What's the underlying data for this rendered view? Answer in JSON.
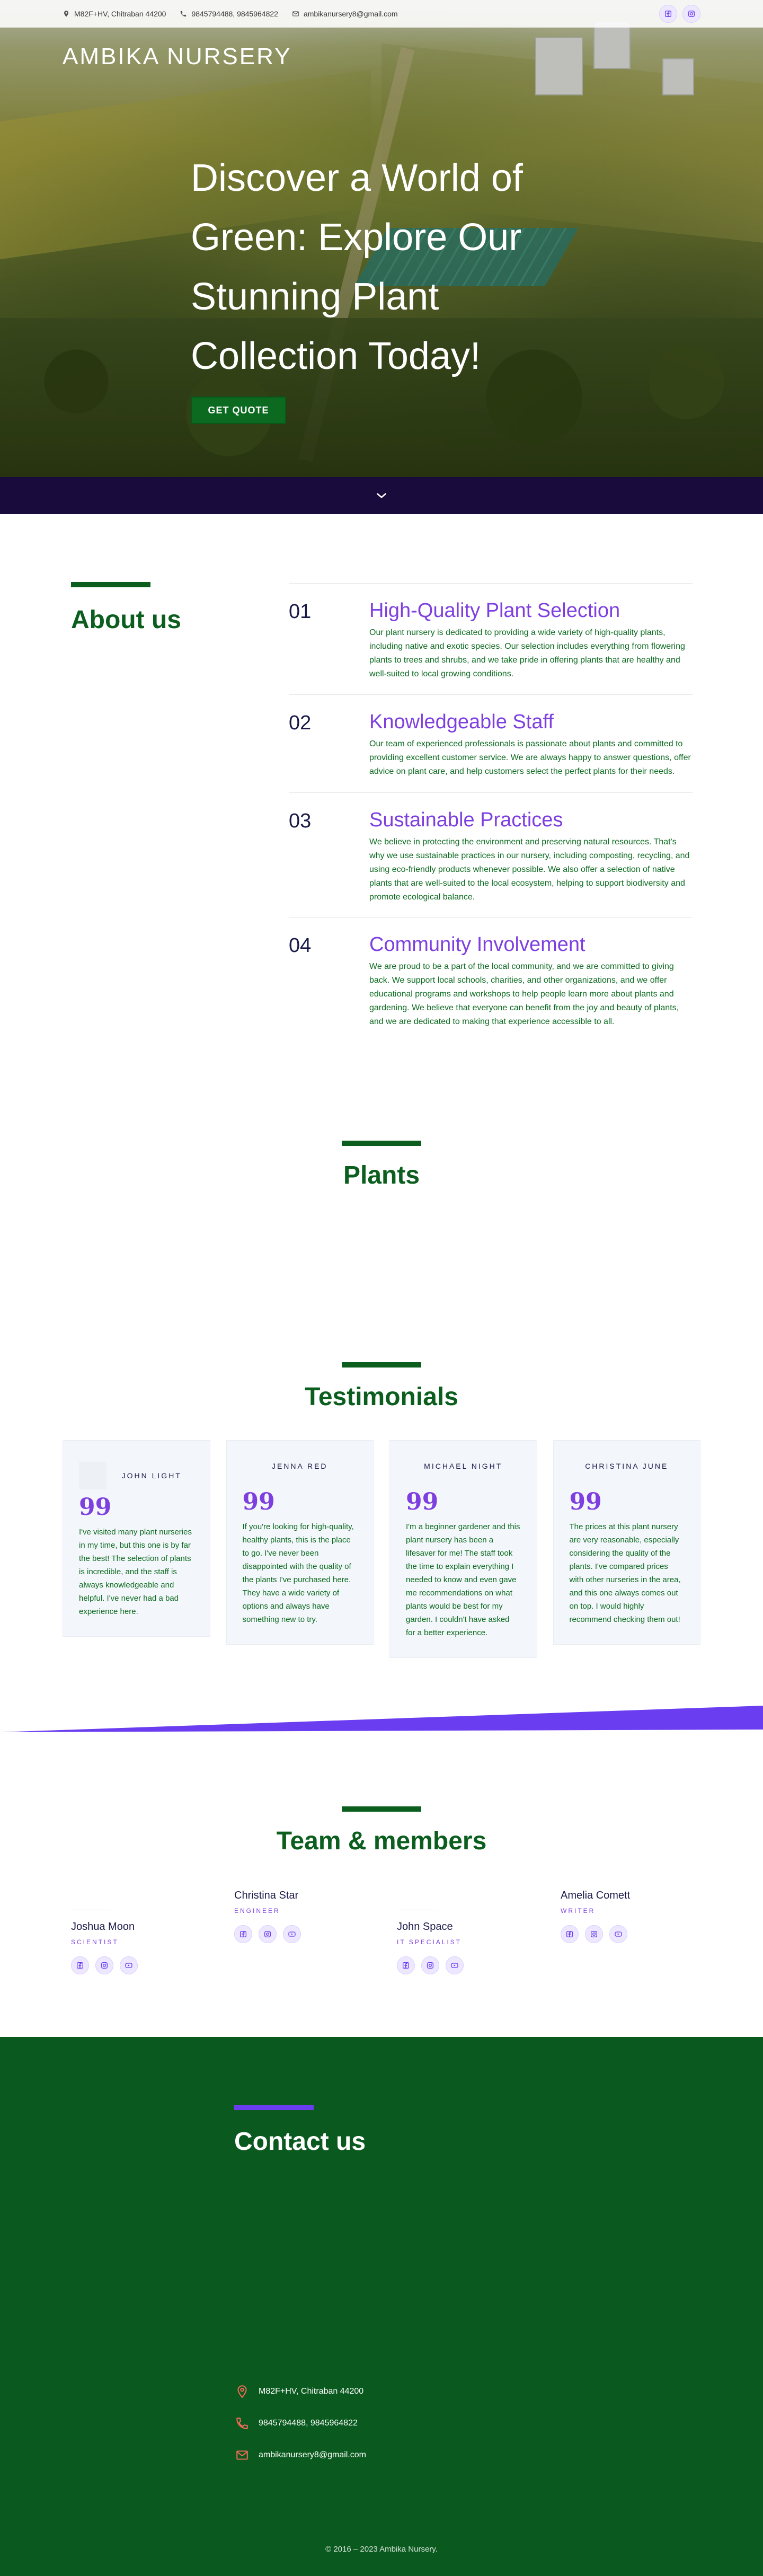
{
  "topbar": {
    "address": "M82F+HV, Chitraban 44200",
    "phone": "9845794488, 9845964822",
    "email": "ambikanursery8@gmail.com"
  },
  "hero": {
    "brand": "AMBIKA NURSERY",
    "title": "Discover a World of Green: Explore Our Stunning Plant Collection Today!",
    "cta": "GET QUOTE"
  },
  "about": {
    "heading": "About us",
    "items": [
      {
        "num": "01",
        "title": "High-Quality Plant Selection",
        "text": "Our plant nursery is dedicated to providing a wide variety of high-quality plants, including native and exotic species. Our selection includes everything from flowering plants to trees and shrubs, and we take pride in offering plants that are healthy and well-suited to local growing conditions."
      },
      {
        "num": "02",
        "title": "Knowledgeable Staff",
        "text": "Our team of experienced professionals is passionate about plants and committed to providing excellent customer service. We are always happy to answer questions, offer advice on plant care, and help customers select the perfect plants for their needs."
      },
      {
        "num": "03",
        "title": "Sustainable Practices",
        "text": "We believe in protecting the environment and preserving natural resources. That's why we use sustainable practices in our nursery, including composting, recycling, and using eco-friendly products whenever possible. We also offer a selection of native plants that are well-suited to the local ecosystem, helping to support biodiversity and promote ecological balance."
      },
      {
        "num": "04",
        "title": "Community Involvement",
        "text": "We are proud to be a part of the local community, and we are committed to giving back. We support local schools, charities, and other organizations, and we offer educational programs and workshops to help people learn more about plants and gardening. We believe that everyone can benefit from the joy and beauty of plants, and we are dedicated to making that experience accessible to all."
      }
    ]
  },
  "plants": {
    "heading": "Plants"
  },
  "testimonials": {
    "heading": "Testimonials",
    "cards": [
      {
        "name": "JOHN LIGHT",
        "quote_mark": "99",
        "text": "I've visited many plant nurseries in my time, but this one is by far the best! The selection of plants is incredible, and the staff is always knowledgeable and helpful. I've never had a bad experience here."
      },
      {
        "name": "JENNA RED",
        "quote_mark": "99",
        "text": "If you're looking for high-quality, healthy plants, this is the place to go. I've never been disappointed with the quality of the plants I've purchased here. They have a wide variety of options and always have something new to try."
      },
      {
        "name": "MICHAEL NIGHT",
        "quote_mark": "99",
        "text": "I'm a beginner gardener and this plant nursery has been a lifesaver for me! The staff took the time to explain everything I needed to know and even gave me recommendations on what plants would be best for my garden. I couldn't have asked for a better experience."
      },
      {
        "name": "CHRISTINA JUNE",
        "quote_mark": "99",
        "text": "The prices at this plant nursery are very reasonable, especially considering the quality of the plants. I've compared prices with other nurseries in the area, and this one always comes out on top. I would highly recommend checking them out!"
      }
    ]
  },
  "team": {
    "heading": "Team & members",
    "members": [
      {
        "name": "Joshua Moon",
        "role": "SCIENTIST"
      },
      {
        "name": "Christina Star",
        "role": "ENGINEER"
      },
      {
        "name": "John Space",
        "role": "IT SPECIALIST"
      },
      {
        "name": "Amelia Comett",
        "role": "WRITER"
      }
    ]
  },
  "contact": {
    "heading": "Contact us",
    "address": "M82F+HV, Chitraban 44200",
    "phone": "9845794488, 9845964822",
    "email": "ambikanursery8@gmail.com"
  },
  "footer": {
    "copyright": "© 2016 – 2023 Ambika Nursery."
  },
  "colors": {
    "green": "#0b5e1e",
    "purple": "#7e3fe0",
    "navy": "#1a0b3d"
  },
  "icons": [
    "map-pin-icon",
    "phone-icon",
    "mail-icon",
    "facebook-icon",
    "instagram-icon",
    "youtube-icon",
    "chevron-down-icon",
    "quote-icon"
  ]
}
